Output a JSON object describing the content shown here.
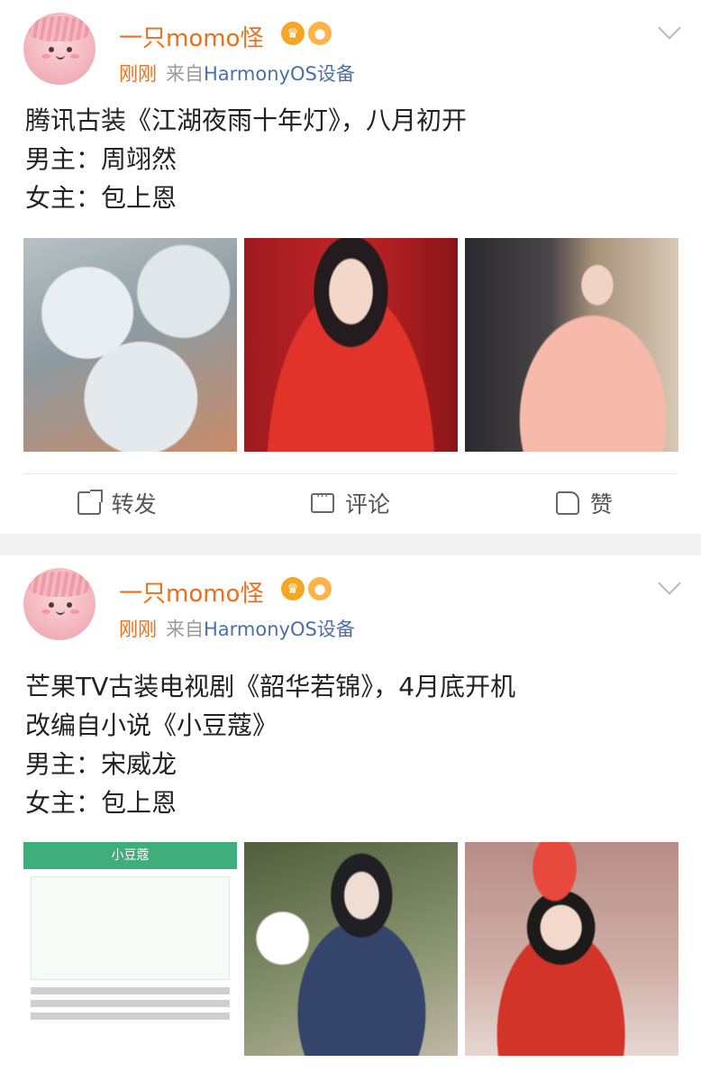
{
  "posts": [
    {
      "username": "一只momo怪",
      "time": "刚刚",
      "source_prefix": "来自",
      "device": "HarmonyOS设备",
      "lines": [
        "腾讯古装《江湖夜雨十年灯》，八月初开",
        "男主：周翊然",
        "女主：包上恩"
      ],
      "images": [
        "umbrella-still-image",
        "male-lead-red-fan-image",
        "female-lead-pink-gown-image"
      ],
      "actions": {
        "repost": "转发",
        "comment": "评论",
        "like": "赞"
      }
    },
    {
      "username": "一只momo怪",
      "time": "刚刚",
      "source_prefix": "来自",
      "device": "HarmonyOS设备",
      "lines": [
        "芒果TV古装电视剧《韶华若锦》，4月底开机",
        "改编自小说《小豆蔻》",
        "男主：宋威龙",
        "女主：包上恩"
      ],
      "images": [
        "novel-page-screenshot-image",
        "male-lead-hanfu-image",
        "female-lead-crown-image"
      ],
      "novel_title": "小豆蔻"
    }
  ],
  "colors": {
    "username": "#f06d1a",
    "device": "#4a6fa5",
    "meta_gray": "#9a9a9a"
  }
}
